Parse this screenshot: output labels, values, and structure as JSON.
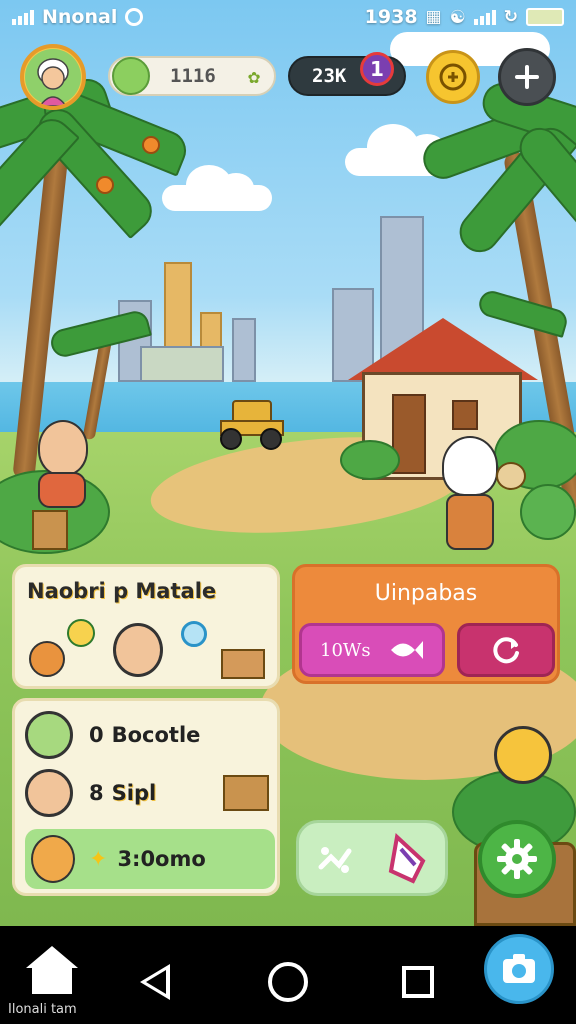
{
  "status_bar": {
    "carrier": "Nnonal",
    "time": "1938"
  },
  "hud": {
    "player_avatar": "grandma-avatar-icon",
    "coins": "1116",
    "gems": "23K",
    "notification_count": "1"
  },
  "panels": {
    "left_panel_title": "Naobri p Matale",
    "orange_panel_title": "Uinpabas",
    "pink_button_label": "10Ws",
    "list": [
      {
        "label": "Bocotle",
        "prefix": "0"
      },
      {
        "label": "Sipl",
        "prefix": "8"
      },
      {
        "label": "3:0omo"
      }
    ]
  },
  "nav": {
    "home_label": "Ilonali tam"
  },
  "colors": {
    "orange_panel": "#ed8a3c",
    "pink_button": "#d94db8",
    "magenta_button": "#c8336e",
    "settings_button": "#4db546",
    "camera_button": "#49b7ec"
  }
}
